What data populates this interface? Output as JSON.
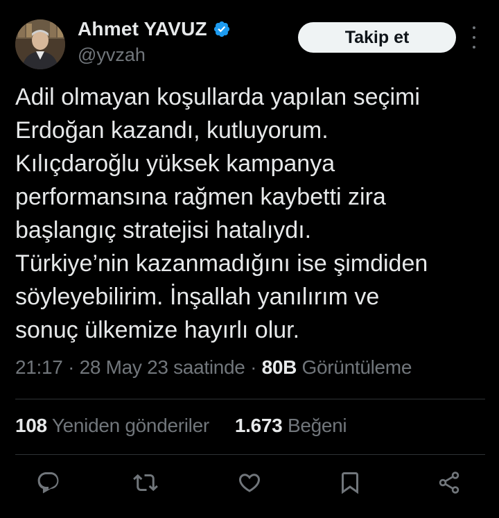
{
  "author": {
    "display_name": "Ahmet YAVUZ",
    "handle": "@yvzah",
    "verified": true,
    "avatar_icon": "profile-photo"
  },
  "header": {
    "follow_label": "Takip et",
    "more_icon": "more-horizontal-icon"
  },
  "tweet": {
    "lines": [
      "Adil olmayan koşullarda yapılan seçimi",
      "Erdoğan kazandı, kutluyorum.",
      "Kılıçdaroğlu yüksek kampanya",
      "performansına rağmen kaybetti zira",
      "başlangıç stratejisi hatalıydı.",
      "Türkiye’nin kazanmadığını ise şimdiden",
      "söyleyebilirim. İnşallah yanılırım ve",
      "sonuç ülkemize hayırlı olur."
    ]
  },
  "meta": {
    "time": "21:17",
    "separator": "·",
    "date": "28 May 23 saatinde",
    "views_count": "80B",
    "views_label": "Görüntüleme"
  },
  "stats": {
    "reposts_count": "108",
    "reposts_label": "Yeniden gönderiler",
    "likes_count": "1.673",
    "likes_label": "Beğeni"
  },
  "actions": [
    "reply-icon",
    "repost-icon",
    "like-icon",
    "bookmark-icon",
    "share-icon"
  ],
  "colors": {
    "background": "#000000",
    "text_primary": "#e7e9ea",
    "text_secondary": "#71767b",
    "verified_badge": "#1d9bf0",
    "follow_button_bg": "#eff3f4",
    "divider": "#2f3336"
  }
}
